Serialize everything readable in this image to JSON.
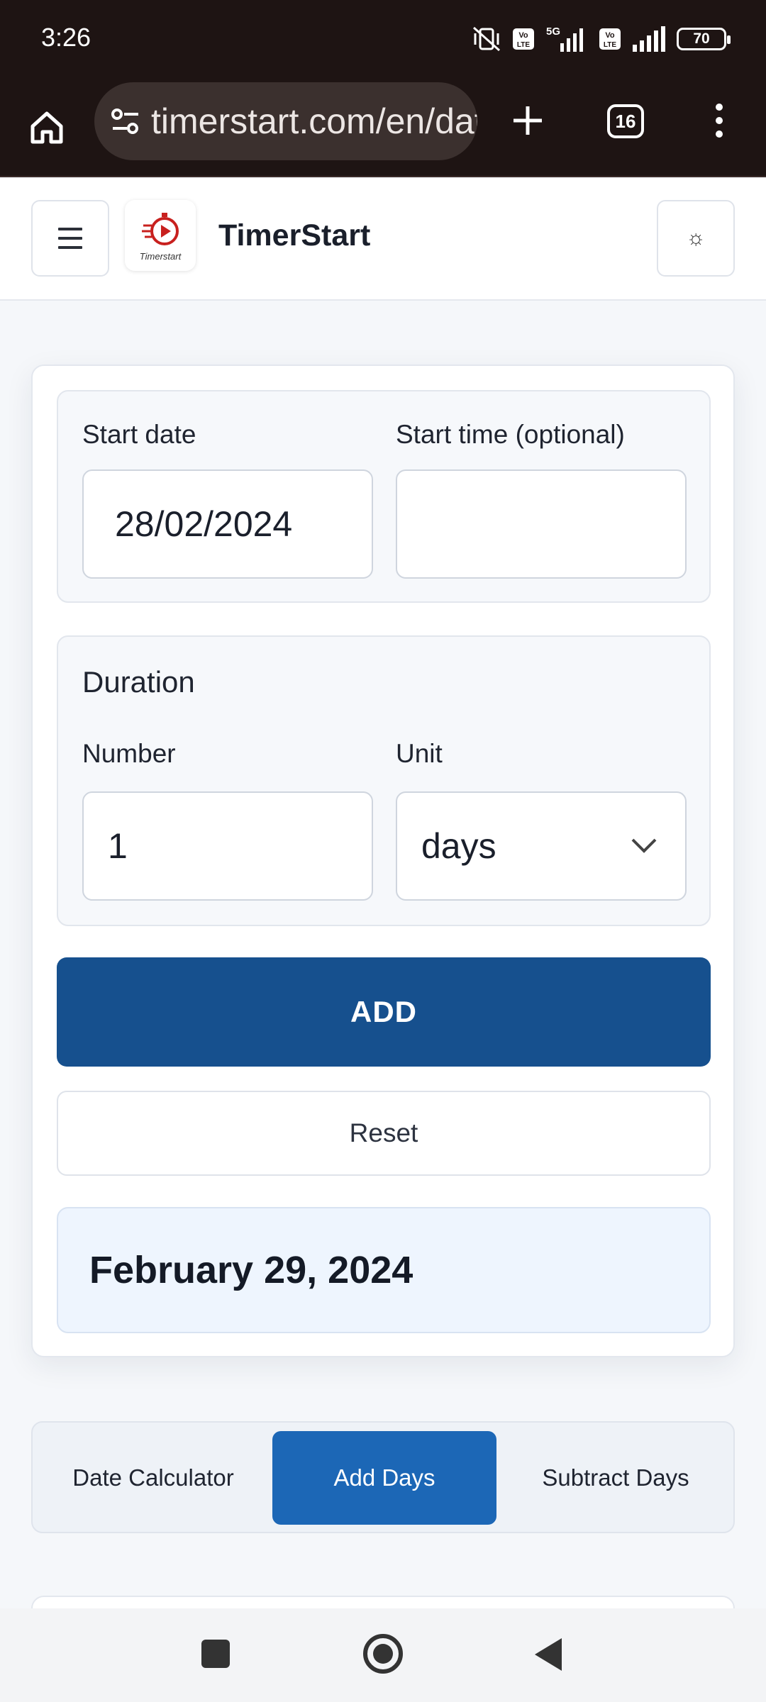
{
  "status_bar": {
    "time": "3:26",
    "network_label": "5G",
    "battery_level": "70",
    "icons": [
      "mute-vibrate-icon",
      "volte-icon",
      "signal-icon",
      "volte-icon",
      "signal-icon",
      "battery-icon"
    ]
  },
  "browser": {
    "url": "timerstart.com/en/date-calculator/add-days",
    "tab_count": "16"
  },
  "site": {
    "title": "TimerStart",
    "logo_text": "Timerstart",
    "theme_icon": "☼"
  },
  "form": {
    "start_date_label": "Start date",
    "start_date_value": "28/02/2024",
    "start_time_label": "Start time (optional)",
    "start_time_value": "",
    "duration_heading": "Duration",
    "number_label": "Number",
    "number_value": "1",
    "unit_label": "Unit",
    "unit_value": "days",
    "add_label": "ADD",
    "reset_label": "Reset"
  },
  "result": {
    "text": "February 29, 2024"
  },
  "tool_tabs": [
    {
      "label": "Date Calculator",
      "active": false
    },
    {
      "label": "Add Days",
      "active": true
    },
    {
      "label": "Subtract Days",
      "active": false
    }
  ],
  "colors": {
    "primary_button": "#16508e",
    "active_tab": "#1c67b6",
    "browser_chrome": "#1e1413",
    "result_bg": "#eef5fe"
  }
}
